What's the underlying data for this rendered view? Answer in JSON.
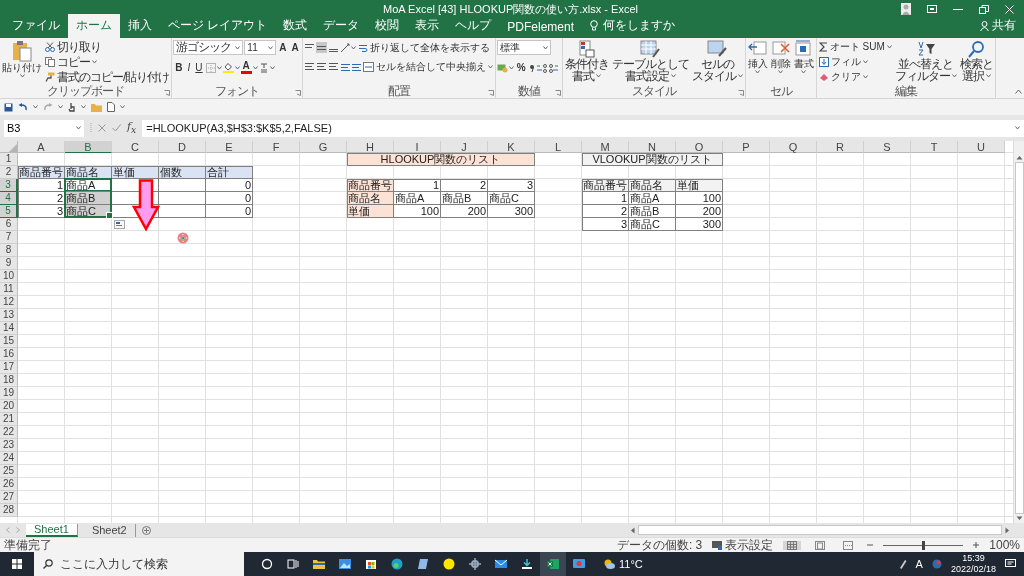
{
  "window": {
    "title": "MoA Excel [43] HLOOKUP関数の使い方.xlsx  -  Excel"
  },
  "ribbon_tabs": [
    {
      "label": "ファイル",
      "selected": false
    },
    {
      "label": "ホーム",
      "selected": true
    },
    {
      "label": "挿入",
      "selected": false
    },
    {
      "label": "ページ レイアウト",
      "selected": false
    },
    {
      "label": "数式",
      "selected": false
    },
    {
      "label": "データ",
      "selected": false
    },
    {
      "label": "校閲",
      "selected": false
    },
    {
      "label": "表示",
      "selected": false
    },
    {
      "label": "ヘルプ",
      "selected": false
    },
    {
      "label": "PDFelement",
      "selected": false
    }
  ],
  "tell_me": "何をしますか",
  "share": "共有",
  "ribbon_groups": [
    {
      "kind": "clipboard",
      "label": "クリップボード",
      "paste": "貼り付け",
      "items": [
        "切り取り",
        "コピー",
        "書式のコピー/貼り付け"
      ]
    },
    {
      "kind": "font",
      "label": "フォント",
      "font": "游ゴシック",
      "size": "11",
      "size_buttons": [
        "A",
        "A"
      ],
      "styles": [
        "B",
        "I",
        "U"
      ],
      "font_color": "A"
    },
    {
      "kind": "alignment",
      "label": "配置",
      "wrap": "折り返して全体を表示する",
      "merge": "セルを結合して中央揃え"
    },
    {
      "kind": "number",
      "label": "数値",
      "format": "標準",
      "percent": "%"
    },
    {
      "kind": "styles",
      "label": "スタイル",
      "buttons": [
        {
          "lines": [
            "条件付き",
            "書式"
          ]
        },
        {
          "lines": [
            "テーブルとして",
            "書式設定"
          ]
        },
        {
          "lines": [
            "セルの",
            "スタイル"
          ]
        }
      ]
    },
    {
      "kind": "cells",
      "label": "セル",
      "buttons": [
        "挿入",
        "削除",
        "書式"
      ]
    },
    {
      "kind": "editing",
      "label": "編集",
      "items": [
        "オート SUM",
        "フィル",
        "クリア"
      ],
      "buttons": [
        {
          "lines": [
            "並べ替えと",
            "フィルター"
          ]
        },
        {
          "lines": [
            "検索と",
            "選択"
          ]
        }
      ]
    }
  ],
  "formula_bar": {
    "name_box": "B3",
    "function_label": "f$_{x}$",
    "formula": "=HLOOKUP(A3,$H$3:$K$5,2,FALSE)"
  },
  "sheet": {
    "columns": [
      {
        "label": "A",
        "selected": false
      },
      {
        "label": "B",
        "selected": true
      },
      {
        "label": "C",
        "selected": false
      },
      {
        "label": "D",
        "selected": false
      },
      {
        "label": "E",
        "selected": false
      },
      {
        "label": "F",
        "selected": false
      },
      {
        "label": "G",
        "selected": false
      },
      {
        "label": "H",
        "selected": false
      },
      {
        "label": "I",
        "selected": false
      },
      {
        "label": "J",
        "selected": false
      },
      {
        "label": "K",
        "selected": false
      },
      {
        "label": "L",
        "selected": false
      },
      {
        "label": "M",
        "selected": false
      },
      {
        "label": "N",
        "selected": false
      },
      {
        "label": "O",
        "selected": false
      },
      {
        "label": "P",
        "selected": false
      },
      {
        "label": "Q",
        "selected": false
      },
      {
        "label": "R",
        "selected": false
      },
      {
        "label": "S",
        "selected": false
      },
      {
        "label": "T",
        "selected": false
      },
      {
        "label": "U",
        "selected": false
      }
    ],
    "rows": [
      {
        "label": "1",
        "selected": false
      },
      {
        "label": "2",
        "selected": false
      },
      {
        "label": "3",
        "selected": true
      },
      {
        "label": "4",
        "selected": true
      },
      {
        "label": "5",
        "selected": true
      },
      {
        "label": "6",
        "selected": false
      },
      {
        "label": "7",
        "selected": false
      },
      {
        "label": "8",
        "selected": false
      },
      {
        "label": "9",
        "selected": false
      },
      {
        "label": "10",
        "selected": false
      },
      {
        "label": "11",
        "selected": false
      },
      {
        "label": "12",
        "selected": false
      },
      {
        "label": "13",
        "selected": false
      },
      {
        "label": "14",
        "selected": false
      },
      {
        "label": "15",
        "selected": false
      },
      {
        "label": "16",
        "selected": false
      },
      {
        "label": "17",
        "selected": false
      },
      {
        "label": "18",
        "selected": false
      },
      {
        "label": "19",
        "selected": false
      },
      {
        "label": "20",
        "selected": false
      },
      {
        "label": "21",
        "selected": false
      },
      {
        "label": "22",
        "selected": false
      },
      {
        "label": "23",
        "selected": false
      },
      {
        "label": "24",
        "selected": false
      },
      {
        "label": "25",
        "selected": false
      },
      {
        "label": "26",
        "selected": false
      },
      {
        "label": "27",
        "selected": false
      },
      {
        "label": "28",
        "selected": false
      }
    ],
    "tables": [
      {
        "rows": [
          [
            {
              "text": "商品番号",
              "kind": "text",
              "color": "#dae3f3",
              "selected": false
            },
            {
              "text": "商品名",
              "kind": "text",
              "color": "#dae3f3",
              "selected": false
            },
            {
              "text": "単価",
              "kind": "text",
              "color": "#dae3f3",
              "selected": false
            },
            {
              "text": "個数",
              "kind": "text",
              "color": "#dae3f3",
              "selected": false
            },
            {
              "text": "合計",
              "kind": "text",
              "color": "#dae3f3",
              "selected": false
            }
          ],
          [
            {
              "text": "1",
              "kind": "number",
              "selected": false
            },
            {
              "text": "商品A",
              "kind": "text",
              "selected": true
            },
            {
              "kind": "empty",
              "selected": false
            },
            {
              "kind": "empty",
              "selected": false
            },
            {
              "text": "0",
              "kind": "number",
              "selected": false
            }
          ],
          [
            {
              "text": "2",
              "kind": "number",
              "selected": false
            },
            {
              "text": "商品B",
              "kind": "text",
              "selected": true
            },
            {
              "kind": "empty",
              "selected": false
            },
            {
              "kind": "empty",
              "selected": false
            },
            {
              "text": "0",
              "kind": "number",
              "selected": false
            }
          ],
          [
            {
              "text": "3",
              "kind": "number",
              "selected": false
            },
            {
              "text": "商品C",
              "kind": "text",
              "selected": true
            },
            {
              "kind": "empty",
              "selected": false
            },
            {
              "kind": "empty",
              "selected": false
            },
            {
              "text": "0",
              "kind": "number",
              "selected": false
            }
          ]
        ]
      },
      {
        "title": {
          "text": "HLOOKUP関数のリスト",
          "color": "#fbe2d5",
          "selected": false
        },
        "rows": [
          [
            {
              "text": "商品番号",
              "kind": "text",
              "color": "#fbe2d5",
              "selected": false
            },
            {
              "text": "1",
              "kind": "number",
              "selected": false
            },
            {
              "text": "2",
              "kind": "number",
              "selected": false
            },
            {
              "text": "3",
              "kind": "number",
              "selected": false
            }
          ],
          [
            {
              "text": "商品名",
              "kind": "text",
              "color": "#fbe2d5",
              "selected": false
            },
            {
              "text": "商品A",
              "kind": "text",
              "selected": false
            },
            {
              "text": "商品B",
              "kind": "text",
              "selected": false
            },
            {
              "text": "商品C",
              "kind": "text",
              "selected": false
            }
          ],
          [
            {
              "text": "単価",
              "kind": "text",
              "color": "#fbe2d5",
              "selected": false
            },
            {
              "text": "100",
              "kind": "number",
              "selected": false
            },
            {
              "text": "200",
              "kind": "number",
              "selected": false
            },
            {
              "text": "300",
              "kind": "number",
              "selected": false
            }
          ]
        ]
      },
      {
        "title": {
          "text": "VLOOKUP関数のリスト",
          "color": "#f2f2f2",
          "selected": false
        },
        "rows": [
          [
            {
              "text": "商品番号",
              "kind": "text",
              "color": "#f2f2f2",
              "selected": false
            },
            {
              "text": "商品名",
              "kind": "text",
              "color": "#f2f2f2",
              "selected": false
            },
            {
              "text": "単価",
              "kind": "text",
              "color": "#f2f2f2",
              "selected": false
            }
          ],
          [
            {
              "text": "1",
              "kind": "number",
              "selected": false
            },
            {
              "text": "商品A",
              "kind": "text",
              "selected": false
            },
            {
              "text": "100",
              "kind": "number",
              "selected": false
            }
          ],
          [
            {
              "text": "2",
              "kind": "number",
              "selected": false
            },
            {
              "text": "商品B",
              "kind": "text",
              "selected": false
            },
            {
              "text": "200",
              "kind": "number",
              "selected": false
            }
          ],
          [
            {
              "text": "3",
              "kind": "number",
              "selected": false
            },
            {
              "text": "商品C",
              "kind": "text",
              "selected": false
            },
            {
              "text": "300",
              "kind": "number",
              "selected": false
            }
          ]
        ]
      }
    ]
  },
  "sheet_tabs": [
    {
      "label": "Sheet1",
      "selected": true
    },
    {
      "label": "Sheet2",
      "selected": false
    }
  ],
  "status_bar": {
    "status": "準備完了",
    "count": "データの個数: 3",
    "display_settings": "表示設定",
    "zoom": {
      "level": 0.5
    },
    "zoom_label": "100%"
  },
  "taskbar": {
    "search_placeholder": "ここに入力して検索",
    "apps": [
      {
        "selected": false
      },
      {
        "selected": false
      },
      {
        "selected": false
      },
      {
        "selected": false
      },
      {
        "selected": false
      },
      {
        "selected": false
      },
      {
        "selected": false
      },
      {
        "selected": false
      },
      {
        "selected": false
      },
      {
        "selected": false
      },
      {
        "selected": false
      },
      {
        "selected": true
      },
      {
        "selected": false
      }
    ],
    "weather": "11°C",
    "ime": "A",
    "time": "15:39",
    "date": "2022/02/18"
  }
}
